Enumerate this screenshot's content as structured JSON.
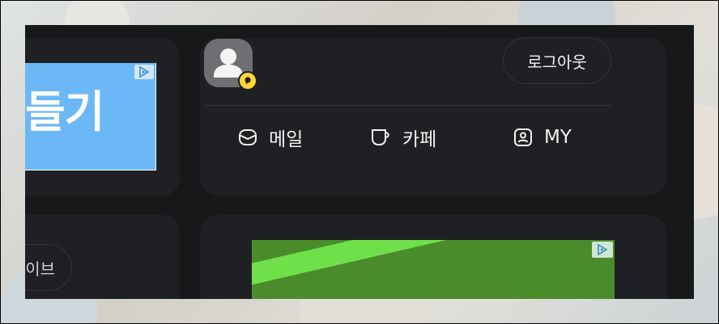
{
  "ads": {
    "top_banner_text": "들기",
    "adchoices_icon": "adchoices-icon"
  },
  "profile": {
    "logout_label": "로그아웃",
    "avatar_icon": "user-avatar-icon",
    "badge_icon": "chat-badge-icon"
  },
  "shortcuts": [
    {
      "label": "메일",
      "icon": "mail-icon"
    },
    {
      "label": "카페",
      "icon": "cup-icon"
    },
    {
      "label": "MY",
      "icon": "profile-card-icon"
    }
  ],
  "left_bottom": {
    "button_label": "이브"
  },
  "colors": {
    "panel_bg": "#17181a",
    "card_bg": "#1f2023",
    "text": "#f2f2f2",
    "badge": "#ffd83a",
    "top_ad_bg": "#6cb8f6",
    "bottom_ad_bg": "#4a8c2c",
    "bottom_ad_stripe": "#6fe04a"
  }
}
